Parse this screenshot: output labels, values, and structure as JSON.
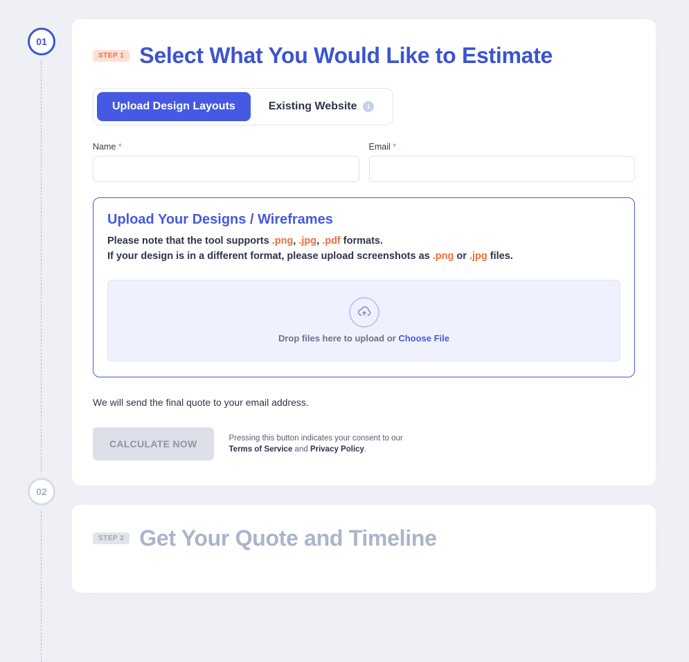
{
  "steps": {
    "one": {
      "marker": "01",
      "badge": "STEP 1",
      "title": "Select What You Would Like to Estimate"
    },
    "two": {
      "marker": "02",
      "badge": "STEP 2",
      "title": "Get Your Quote and Timeline"
    }
  },
  "tabs": {
    "upload": "Upload Design Layouts",
    "existing": "Existing Website"
  },
  "fields": {
    "name_label": "Name",
    "email_label": "Email",
    "required": "*"
  },
  "upload": {
    "heading": "Upload Your Designs / Wireframes",
    "note_pre": "Please note that the tool supports ",
    "note_mid1": ", ",
    "note_mid2": ", ",
    "note_post": " formats.",
    "note2_pre": "If your design is in a different format, please upload screenshots as ",
    "note2_or": " or ",
    "note2_post": " files.",
    "ext_png": ".png",
    "ext_jpg": ".jpg",
    "ext_pdf": ".pdf",
    "drop_pre": "Drop files here to upload or ",
    "choose": "Choose File"
  },
  "quote_note": "We will send the final quote to your email address.",
  "cta": {
    "calculate": "CALCULATE NOW",
    "terms_pre": "Pressing this button indicates your consent to our ",
    "tos": "Terms of Service",
    "and": " and ",
    "privacy": "Privacy Policy",
    "dot": "."
  }
}
